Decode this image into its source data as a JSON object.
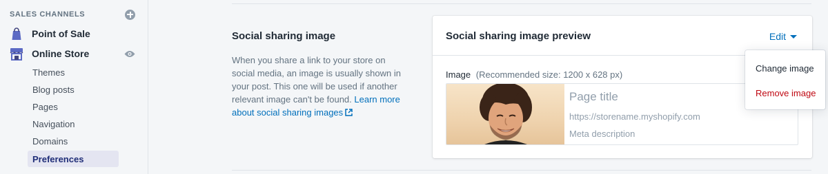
{
  "sidebar": {
    "section_title": "SALES CHANNELS",
    "channels": [
      {
        "label": "Point of Sale",
        "icon": "shopping-bag-icon"
      },
      {
        "label": "Online Store",
        "icon": "storefront-icon"
      }
    ],
    "sub_items": [
      {
        "label": "Themes",
        "active": false
      },
      {
        "label": "Blog posts",
        "active": false
      },
      {
        "label": "Pages",
        "active": false
      },
      {
        "label": "Navigation",
        "active": false
      },
      {
        "label": "Domains",
        "active": false
      },
      {
        "label": "Preferences",
        "active": true
      }
    ]
  },
  "annotation": {
    "title": "Social sharing image",
    "description": "When you share a link to your store on social media, an image is usually shown in your post. This one will be used if another relevant image can't be found.",
    "link_text": "Learn more about social sharing images"
  },
  "card": {
    "title": "Social sharing image preview",
    "edit_label": "Edit",
    "image_label": "Image",
    "image_hint": "(Recommended size: 1200 x 628 px)",
    "preview": {
      "title": "Page title",
      "url": "https://storename.myshopify.com",
      "meta": "Meta description"
    }
  },
  "popover": {
    "change_label": "Change image",
    "remove_label": "Remove image"
  },
  "colors": {
    "link": "#006fbb",
    "destructive": "#bf0711",
    "active_bg": "#e4e5f1",
    "active_text": "#202e78"
  }
}
